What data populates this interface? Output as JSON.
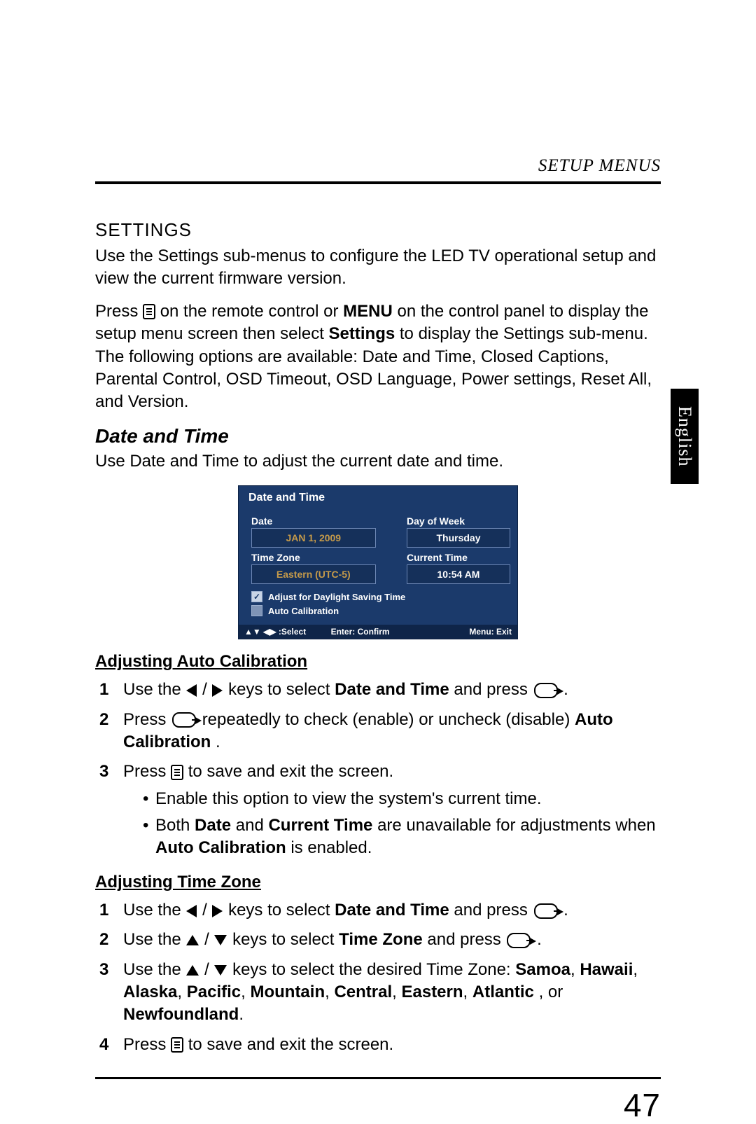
{
  "header": {
    "breadcrumb": "SETUP MENUS"
  },
  "language_tab": "English",
  "settings": {
    "heading": "SETTINGS",
    "intro": "Use the Settings sub-menus to configure the LED TV operational setup and view the current firmware version.",
    "press_prefix": "Press ",
    "press_mid1": " on the remote control or ",
    "menu_word": "MENU",
    "press_mid2": " on the control panel to display the setup menu screen then select ",
    "settings_word": "Settings",
    "press_tail": " to display the Settings sub-menu. The following options are available: Date and Time, Closed Captions, Parental Control, OSD Timeout, OSD Language, Power settings, Reset All, and Version."
  },
  "date_time": {
    "heading": "Date and Time",
    "intro": "Use Date and Time to adjust the current date and time."
  },
  "osd": {
    "title": "Date and Time",
    "labels": {
      "date": "Date",
      "day_of_week": "Day of Week",
      "time_zone": "Time Zone",
      "current_time": "Current Time"
    },
    "values": {
      "date": "JAN 1, 2009",
      "day_of_week": "Thursday",
      "time_zone": "Eastern (UTC-5)",
      "current_time": "10:54 AM"
    },
    "checks": {
      "dst": {
        "checked": true,
        "label": "Adjust for Daylight Saving Time"
      },
      "auto_cal": {
        "checked": false,
        "label": "Auto Calibration"
      }
    },
    "footer": {
      "select": "▲▼ ◀▶ :Select",
      "enter": "Enter: Confirm",
      "menu": "Menu: Exit"
    }
  },
  "auto_cal": {
    "heading": "Adjusting Auto Calibration",
    "s1_a": "Use the ",
    "s1_b": " / ",
    "s1_c": " keys to select ",
    "s1_d": "Date and Time",
    "s1_e": " and press ",
    "s1_f": ".",
    "s2_a": "Press ",
    "s2_b": " repeatedly to check (enable) or uncheck (disable) ",
    "s2_c": "Auto Calibration",
    "s2_d": ".",
    "s3_a": "Press ",
    "s3_b": " to save and exit the screen.",
    "b1": "Enable this option to view the system's current time.",
    "b2_a": "Both ",
    "b2_b": "Date",
    "b2_c": " and ",
    "b2_d": "Current Time",
    "b2_e": " are unavailable for adjustments when ",
    "b2_f": "Auto Calibration",
    "b2_g": " is enabled."
  },
  "tz": {
    "heading": "Adjusting Time Zone",
    "s1_a": "Use the ",
    "s1_b": " / ",
    "s1_c": " keys to select ",
    "s1_d": "Date and Time",
    "s1_e": " and press ",
    "s1_f": ".",
    "s2_a": "Use the ",
    "s2_b": " / ",
    "s2_c": " keys to select ",
    "s2_d": "Time Zone",
    "s2_e": " and press ",
    "s2_f": ".",
    "s3_a": "Use the ",
    "s3_b": " / ",
    "s3_c": " keys to select the desired Time Zone: ",
    "s3_list_a": "Samoa",
    "s3_sep": ", ",
    "s3_list_b": "Hawaii",
    "s3_list_c": "Alaska",
    "s3_list_d": "Pacific",
    "s3_list_e": "Mountain",
    "s3_list_f": "Central",
    "s3_list_g": "Eastern",
    "s3_list_h": "Atlantic",
    "s3_or": ", or ",
    "s3_list_i": "Newfoundland",
    "s3_tail": ".",
    "s4_a": "Press ",
    "s4_b": " to save and exit the screen."
  },
  "page_number": "47"
}
